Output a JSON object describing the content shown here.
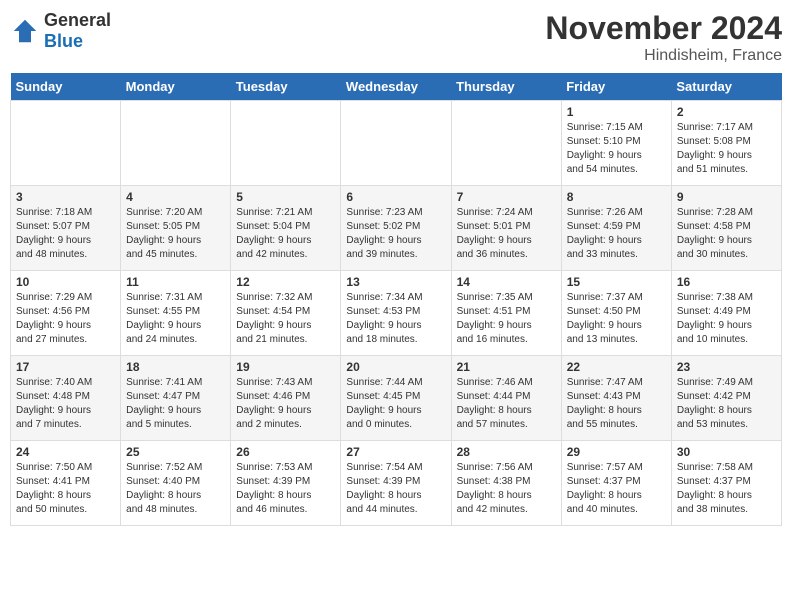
{
  "logo": {
    "text_general": "General",
    "text_blue": "Blue"
  },
  "title": "November 2024",
  "subtitle": "Hindisheim, France",
  "headers": [
    "Sunday",
    "Monday",
    "Tuesday",
    "Wednesday",
    "Thursday",
    "Friday",
    "Saturday"
  ],
  "weeks": [
    [
      {
        "day": "",
        "info": ""
      },
      {
        "day": "",
        "info": ""
      },
      {
        "day": "",
        "info": ""
      },
      {
        "day": "",
        "info": ""
      },
      {
        "day": "",
        "info": ""
      },
      {
        "day": "1",
        "info": "Sunrise: 7:15 AM\nSunset: 5:10 PM\nDaylight: 9 hours\nand 54 minutes."
      },
      {
        "day": "2",
        "info": "Sunrise: 7:17 AM\nSunset: 5:08 PM\nDaylight: 9 hours\nand 51 minutes."
      }
    ],
    [
      {
        "day": "3",
        "info": "Sunrise: 7:18 AM\nSunset: 5:07 PM\nDaylight: 9 hours\nand 48 minutes."
      },
      {
        "day": "4",
        "info": "Sunrise: 7:20 AM\nSunset: 5:05 PM\nDaylight: 9 hours\nand 45 minutes."
      },
      {
        "day": "5",
        "info": "Sunrise: 7:21 AM\nSunset: 5:04 PM\nDaylight: 9 hours\nand 42 minutes."
      },
      {
        "day": "6",
        "info": "Sunrise: 7:23 AM\nSunset: 5:02 PM\nDaylight: 9 hours\nand 39 minutes."
      },
      {
        "day": "7",
        "info": "Sunrise: 7:24 AM\nSunset: 5:01 PM\nDaylight: 9 hours\nand 36 minutes."
      },
      {
        "day": "8",
        "info": "Sunrise: 7:26 AM\nSunset: 4:59 PM\nDaylight: 9 hours\nand 33 minutes."
      },
      {
        "day": "9",
        "info": "Sunrise: 7:28 AM\nSunset: 4:58 PM\nDaylight: 9 hours\nand 30 minutes."
      }
    ],
    [
      {
        "day": "10",
        "info": "Sunrise: 7:29 AM\nSunset: 4:56 PM\nDaylight: 9 hours\nand 27 minutes."
      },
      {
        "day": "11",
        "info": "Sunrise: 7:31 AM\nSunset: 4:55 PM\nDaylight: 9 hours\nand 24 minutes."
      },
      {
        "day": "12",
        "info": "Sunrise: 7:32 AM\nSunset: 4:54 PM\nDaylight: 9 hours\nand 21 minutes."
      },
      {
        "day": "13",
        "info": "Sunrise: 7:34 AM\nSunset: 4:53 PM\nDaylight: 9 hours\nand 18 minutes."
      },
      {
        "day": "14",
        "info": "Sunrise: 7:35 AM\nSunset: 4:51 PM\nDaylight: 9 hours\nand 16 minutes."
      },
      {
        "day": "15",
        "info": "Sunrise: 7:37 AM\nSunset: 4:50 PM\nDaylight: 9 hours\nand 13 minutes."
      },
      {
        "day": "16",
        "info": "Sunrise: 7:38 AM\nSunset: 4:49 PM\nDaylight: 9 hours\nand 10 minutes."
      }
    ],
    [
      {
        "day": "17",
        "info": "Sunrise: 7:40 AM\nSunset: 4:48 PM\nDaylight: 9 hours\nand 7 minutes."
      },
      {
        "day": "18",
        "info": "Sunrise: 7:41 AM\nSunset: 4:47 PM\nDaylight: 9 hours\nand 5 minutes."
      },
      {
        "day": "19",
        "info": "Sunrise: 7:43 AM\nSunset: 4:46 PM\nDaylight: 9 hours\nand 2 minutes."
      },
      {
        "day": "20",
        "info": "Sunrise: 7:44 AM\nSunset: 4:45 PM\nDaylight: 9 hours\nand 0 minutes."
      },
      {
        "day": "21",
        "info": "Sunrise: 7:46 AM\nSunset: 4:44 PM\nDaylight: 8 hours\nand 57 minutes."
      },
      {
        "day": "22",
        "info": "Sunrise: 7:47 AM\nSunset: 4:43 PM\nDaylight: 8 hours\nand 55 minutes."
      },
      {
        "day": "23",
        "info": "Sunrise: 7:49 AM\nSunset: 4:42 PM\nDaylight: 8 hours\nand 53 minutes."
      }
    ],
    [
      {
        "day": "24",
        "info": "Sunrise: 7:50 AM\nSunset: 4:41 PM\nDaylight: 8 hours\nand 50 minutes."
      },
      {
        "day": "25",
        "info": "Sunrise: 7:52 AM\nSunset: 4:40 PM\nDaylight: 8 hours\nand 48 minutes."
      },
      {
        "day": "26",
        "info": "Sunrise: 7:53 AM\nSunset: 4:39 PM\nDaylight: 8 hours\nand 46 minutes."
      },
      {
        "day": "27",
        "info": "Sunrise: 7:54 AM\nSunset: 4:39 PM\nDaylight: 8 hours\nand 44 minutes."
      },
      {
        "day": "28",
        "info": "Sunrise: 7:56 AM\nSunset: 4:38 PM\nDaylight: 8 hours\nand 42 minutes."
      },
      {
        "day": "29",
        "info": "Sunrise: 7:57 AM\nSunset: 4:37 PM\nDaylight: 8 hours\nand 40 minutes."
      },
      {
        "day": "30",
        "info": "Sunrise: 7:58 AM\nSunset: 4:37 PM\nDaylight: 8 hours\nand 38 minutes."
      }
    ]
  ]
}
